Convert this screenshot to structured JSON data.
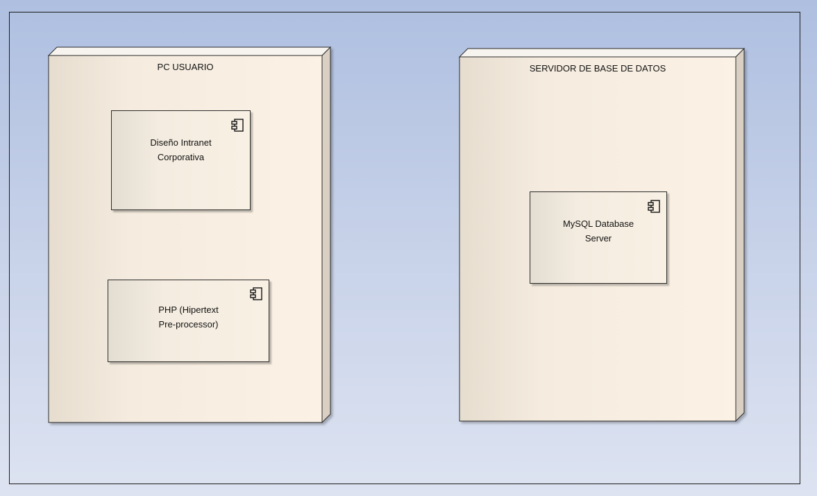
{
  "diagram": {
    "nodes": [
      {
        "label": "PC USUARIO",
        "components": [
          {
            "line1": "Diseño Intranet",
            "line2": "Corporativa"
          },
          {
            "line1": "PHP (Hipertext",
            "line2": "Pre-processor)"
          }
        ]
      },
      {
        "label": "SERVIDOR DE BASE DE DATOS",
        "components": [
          {
            "line1": "MySQL Database",
            "line2": "Server"
          }
        ]
      }
    ]
  },
  "icons": {
    "component": "uml-component-icon"
  }
}
